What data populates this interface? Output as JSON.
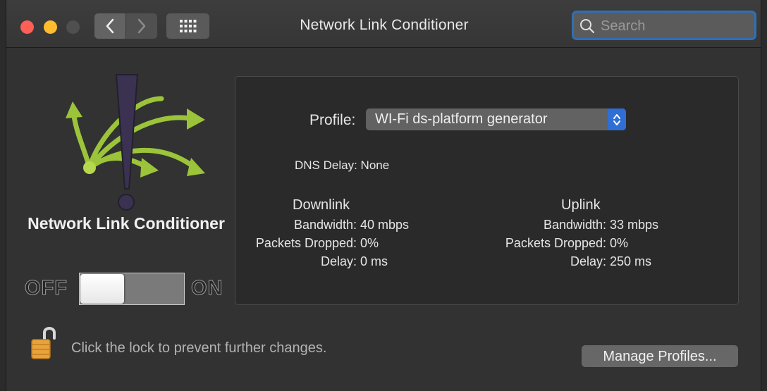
{
  "window": {
    "title": "Network Link Conditioner",
    "search_placeholder": "Search"
  },
  "pane": {
    "app_name": "Network Link Conditioner",
    "switch": {
      "off_label": "OFF",
      "on_label": "ON",
      "state": "off"
    }
  },
  "profile": {
    "label": "Profile:",
    "selected": "WI-Fi ds-platform generator"
  },
  "dns_delay": {
    "label": "DNS Delay:",
    "value": "None"
  },
  "downlink": {
    "title": "Downlink",
    "bandwidth_label": "Bandwidth:",
    "bandwidth_value": "40 mbps",
    "dropped_label": "Packets Dropped:",
    "dropped_value": "0%",
    "delay_label": "Delay:",
    "delay_value": "0 ms"
  },
  "uplink": {
    "title": "Uplink",
    "bandwidth_label": "Bandwidth:",
    "bandwidth_value": "33 mbps",
    "dropped_label": "Packets Dropped:",
    "dropped_value": "0%",
    "delay_label": "Delay:",
    "delay_value": "250 ms"
  },
  "footer": {
    "lock_text": "Click the lock to prevent further changes.",
    "manage_button": "Manage Profiles..."
  },
  "colors": {
    "accent": "#2f6fd5",
    "logo_green": "#9cc43a",
    "close": "#fe5f57",
    "minimize": "#febc2e"
  }
}
